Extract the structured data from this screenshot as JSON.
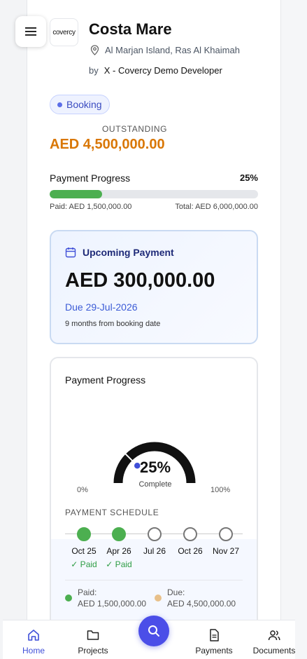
{
  "header": {
    "logo_text": "covercy",
    "title": "Costa Mare",
    "location": "Al Marjan Island, Ras Al Khaimah",
    "by_label": "by",
    "developer": "X - Covercy Demo Developer"
  },
  "status_badge": "Booking",
  "outstanding": {
    "label": "OUTSTANDING",
    "value": "AED 4,500,000.00"
  },
  "progress": {
    "label": "Payment Progress",
    "percent_text": "25%",
    "fraction": 0.25,
    "paid": "Paid: AED 1,500,000.00",
    "total": "Total: AED 6,000,000.00"
  },
  "upcoming": {
    "title": "Upcoming Payment",
    "amount": "AED 300,000.00",
    "due": "Due 29-Jul-2026",
    "note": "9 months from booking date"
  },
  "chart_card": {
    "title": "Payment Progress",
    "gauge_percent": "25%",
    "gauge_sub": "Complete",
    "min_label": "0%",
    "max_label": "100%",
    "schedule_label": "PAYMENT SCHEDULE",
    "schedule": [
      {
        "date": "Oct 25",
        "status": "✓ Paid",
        "done": true
      },
      {
        "date": "Apr 26",
        "status": "✓ Paid",
        "done": true
      },
      {
        "date": "Jul 26",
        "status": "",
        "done": false
      },
      {
        "date": "Oct 26",
        "status": "",
        "done": false
      },
      {
        "date": "Nov 27",
        "status": "",
        "done": false
      }
    ],
    "legend": {
      "paid_label": "Paid:",
      "paid_value": "AED 1,500,000.00",
      "due_label": "Due:",
      "due_value": "AED 4,500,000.00"
    }
  },
  "chart_data": {
    "type": "gauge",
    "value": 25,
    "range": [
      0,
      100
    ],
    "labels": [
      "0%",
      "100%"
    ],
    "center_text": "25%",
    "center_sub": "Complete"
  },
  "nav": {
    "home": "Home",
    "projects": "Projects",
    "payments": "Payments",
    "documents": "Documents"
  },
  "colors": {
    "accent": "#4b4ee8",
    "outstanding": "#d97706",
    "paid": "#4caf50",
    "due": "#e8c08a",
    "gauge_track": "#111111",
    "gauge_marker": "#3f4fd8"
  }
}
